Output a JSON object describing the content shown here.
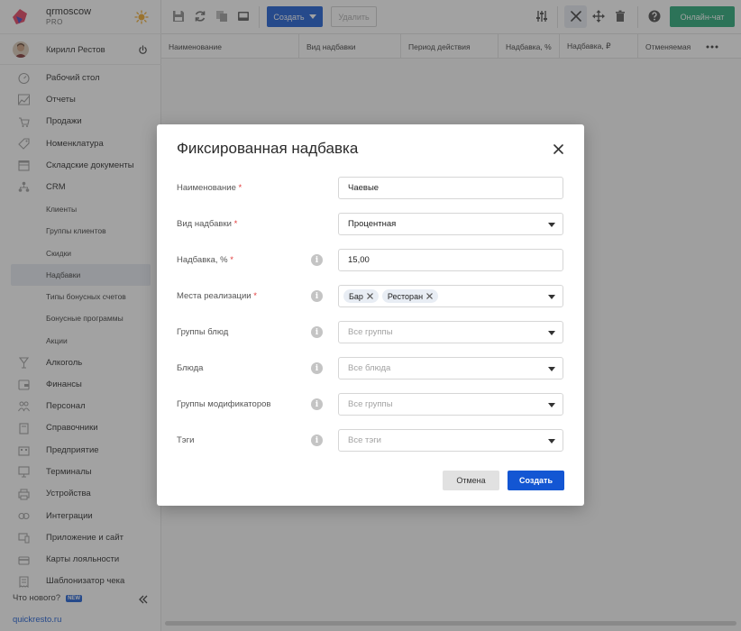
{
  "brand": {
    "name": "qrmoscow",
    "plan": "PRO"
  },
  "user": {
    "name": "Кирилл Рестов"
  },
  "menu": [
    {
      "label": "Рабочий стол",
      "icon": "dashboard-icon",
      "sub": false,
      "active": false
    },
    {
      "label": "Отчеты",
      "icon": "chart-icon",
      "sub": false,
      "active": false
    },
    {
      "label": "Продажи",
      "icon": "cart-icon",
      "sub": false,
      "active": false
    },
    {
      "label": "Номенклатура",
      "icon": "tag-icon",
      "sub": false,
      "active": false
    },
    {
      "label": "Складские документы",
      "icon": "box-icon",
      "sub": false,
      "active": false
    },
    {
      "label": "CRM",
      "icon": "users-tree-icon",
      "sub": false,
      "active": false
    },
    {
      "label": "Клиенты",
      "sub": true,
      "active": false
    },
    {
      "label": "Группы клиентов",
      "sub": true,
      "active": false
    },
    {
      "label": "Скидки",
      "sub": true,
      "active": false
    },
    {
      "label": "Надбавки",
      "sub": true,
      "active": true
    },
    {
      "label": "Типы бонусных счетов",
      "sub": true,
      "active": false
    },
    {
      "label": "Бонусные программы",
      "sub": true,
      "active": false
    },
    {
      "label": "Акции",
      "sub": true,
      "active": false
    },
    {
      "label": "Алкоголь",
      "icon": "glass-icon",
      "sub": false,
      "active": false
    },
    {
      "label": "Финансы",
      "icon": "wallet-icon",
      "sub": false,
      "active": false
    },
    {
      "label": "Персонал",
      "icon": "people-icon",
      "sub": false,
      "active": false
    },
    {
      "label": "Справочники",
      "icon": "book-icon",
      "sub": false,
      "active": false
    },
    {
      "label": "Предприятие",
      "icon": "building-icon",
      "sub": false,
      "active": false
    },
    {
      "label": "Терминалы",
      "icon": "terminal-icon",
      "sub": false,
      "active": false
    },
    {
      "label": "Устройства",
      "icon": "printer-icon",
      "sub": false,
      "active": false
    },
    {
      "label": "Интеграции",
      "icon": "link-icon",
      "sub": false,
      "active": false
    },
    {
      "label": "Приложение и сайт",
      "icon": "device-icon",
      "sub": false,
      "active": false
    },
    {
      "label": "Карты лояльности",
      "icon": "card-icon",
      "sub": false,
      "active": false
    },
    {
      "label": "Шаблонизатор чека",
      "icon": "receipt-icon",
      "sub": false,
      "active": false
    }
  ],
  "footer": {
    "whats_new": "Что нового?",
    "new_badge": "NEW",
    "site": "quickresto.ru"
  },
  "toolbar": {
    "create_label": "Создать",
    "delete_label": "Удалить",
    "online_chat": "Онлайн-чат"
  },
  "table": {
    "columns": [
      "Наименование",
      "Вид надбавки",
      "Период действия",
      "Надбавка, %",
      "Надбавка, ₽",
      "Отменяемая"
    ]
  },
  "modal": {
    "title": "Фиксированная надбавка",
    "fields": {
      "name": {
        "label": "Наименование",
        "value": "Чаевые"
      },
      "type": {
        "label": "Вид надбавки",
        "value": "Процентная"
      },
      "percent": {
        "label": "Надбавка, %",
        "value": "15,00"
      },
      "places": {
        "label": "Места реализации",
        "chips": [
          "Бар",
          "Ресторан"
        ]
      },
      "dish_groups": {
        "label": "Группы блюд",
        "placeholder": "Все группы"
      },
      "dishes": {
        "label": "Блюда",
        "placeholder": "Все блюда"
      },
      "modifier_groups": {
        "label": "Группы модификаторов",
        "placeholder": "Все группы"
      },
      "tags": {
        "label": "Тэги",
        "placeholder": "Все тэги"
      }
    },
    "required_mark": "*",
    "info_glyph": "i",
    "cancel_label": "Отмена",
    "submit_label": "Создать"
  },
  "colors": {
    "primary": "#1356d3",
    "chat": "#1ea672",
    "required": "#e23b3b"
  }
}
